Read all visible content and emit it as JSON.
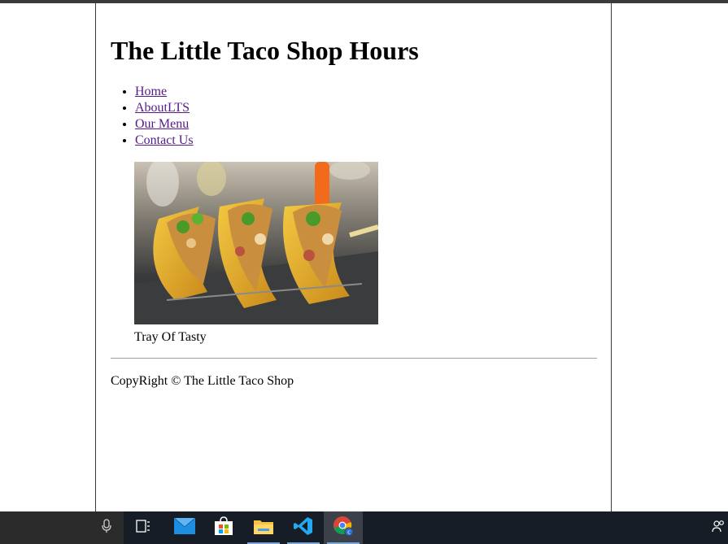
{
  "page": {
    "title": "The Little Taco Shop Hours",
    "nav": [
      {
        "label": "Home"
      },
      {
        "label": "AboutLTS"
      },
      {
        "label": "Our Menu"
      },
      {
        "label": "Contact Us"
      }
    ],
    "figure": {
      "caption": "Tray Of Tasty"
    },
    "footer": "CopyRight © The Little Taco Shop"
  },
  "taskbar": {
    "icons": [
      "microphone-icon",
      "task-view-icon",
      "mail-icon",
      "store-icon",
      "file-explorer-icon",
      "vscode-icon",
      "chrome-icon",
      "people-icon"
    ],
    "active": "chrome-icon"
  }
}
